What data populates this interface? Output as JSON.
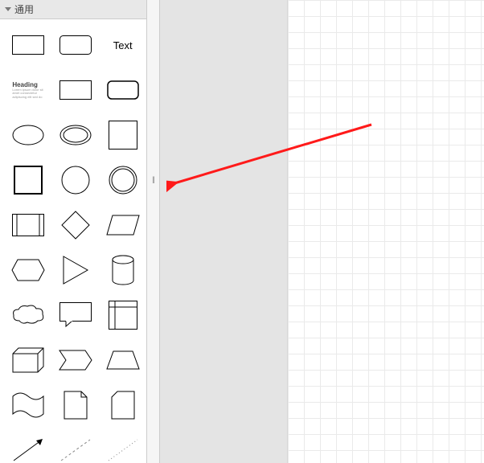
{
  "sidebar": {
    "section_title": "通用",
    "shapes": {
      "text_label": "Text",
      "heading_label": "Heading"
    }
  },
  "splitter": {
    "grip": "||"
  }
}
